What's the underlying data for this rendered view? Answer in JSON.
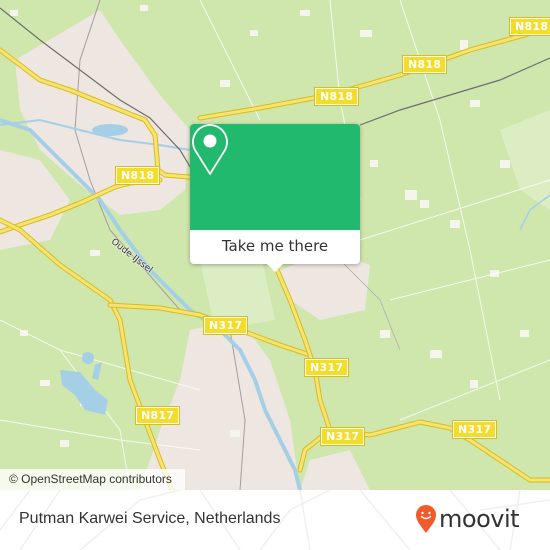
{
  "map": {
    "road_labels": [
      {
        "id": "n818-ne",
        "text": "N818"
      },
      {
        "id": "n818-mid",
        "text": "N818"
      },
      {
        "id": "n818-north",
        "text": "N818"
      },
      {
        "id": "n818-west",
        "text": "N818"
      },
      {
        "id": "n317-west",
        "text": "N317"
      },
      {
        "id": "n317-center",
        "text": "N317"
      },
      {
        "id": "n317-south",
        "text": "N317"
      },
      {
        "id": "n317-east",
        "text": "N317"
      },
      {
        "id": "n817",
        "text": "N817"
      }
    ],
    "river_label": "Oude IJssel",
    "attribution": "© OpenStreetMap contributors",
    "colors": {
      "land": "#cfe6ad",
      "urban": "#ede6e1",
      "water": "#a5cfe6",
      "road": "#f3dc2a",
      "railway": "#6e6e6e"
    }
  },
  "popup": {
    "icon": "map-pin-icon",
    "button_label": "Take me there",
    "color": "#21b96d"
  },
  "footer": {
    "place_name": "Putman Karwei Service, Netherlands",
    "brand": "moovit",
    "brand_color": "#f15a29"
  }
}
